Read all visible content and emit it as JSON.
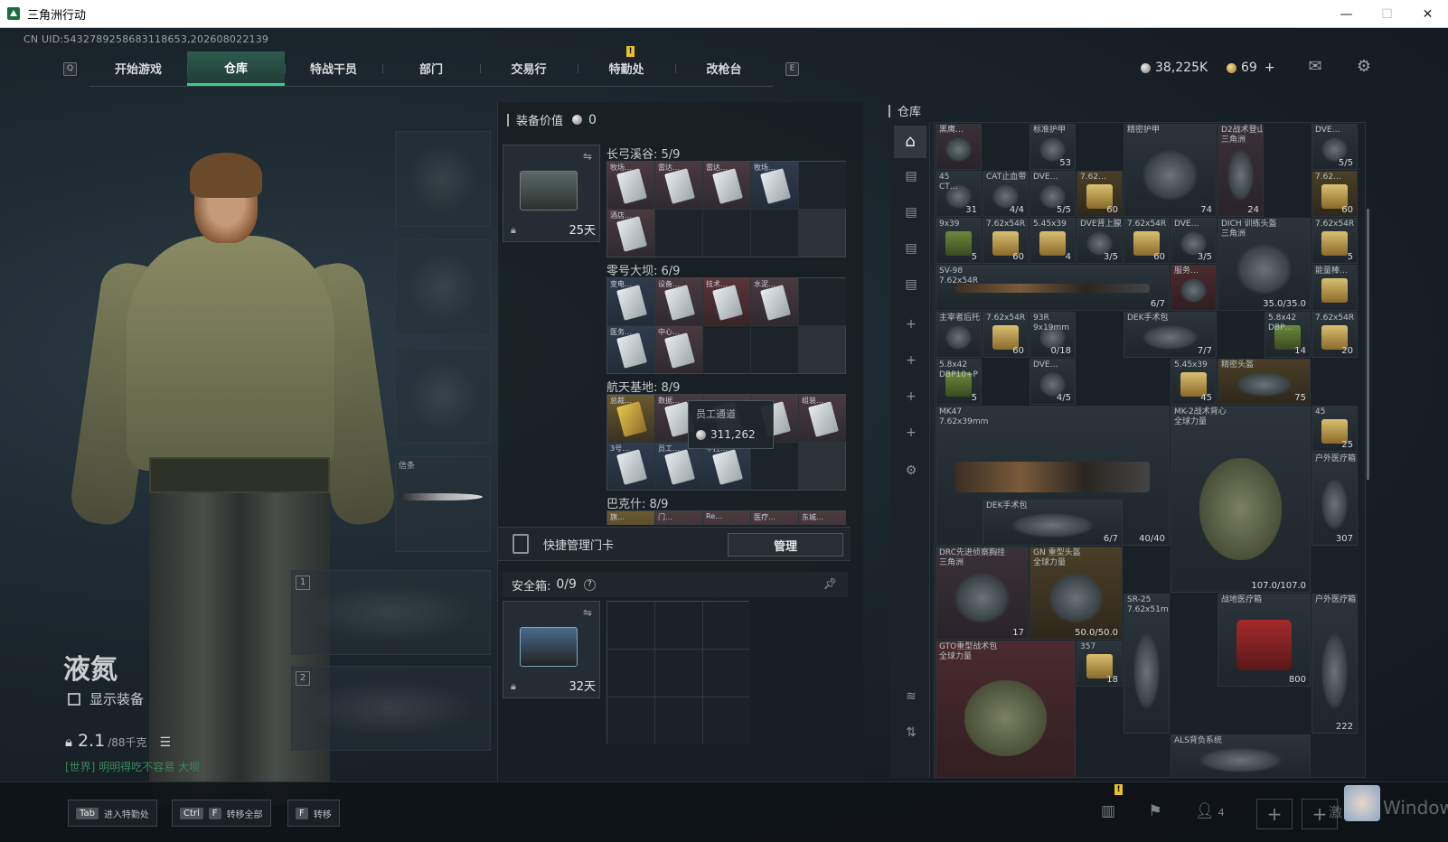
{
  "window": {
    "title": "三角洲行动",
    "minimize": "—",
    "maximize": "☐",
    "close": "✕"
  },
  "uid": "CN UID:5432789258683118653,202608022139",
  "nav": {
    "left_key": "Q",
    "right_key": "E",
    "tabs": [
      "开始游戏",
      "仓库",
      "特战干员",
      "部门",
      "交易行",
      "特勤处",
      "改枪台"
    ],
    "active_tab": "仓库",
    "warn_badge": "!"
  },
  "currency": {
    "silver": "38,225K",
    "gold": "69",
    "add": "+"
  },
  "character": {
    "name": "液氮",
    "show_gear_label": "显示装备",
    "weight": "2.1",
    "weight_max": "/88千克",
    "chat_channel": "[世界]",
    "chat_text": "明明得吃不容易 大坝"
  },
  "slots": {
    "melee_label": "信条",
    "primary_num": "1",
    "secondary_num": "2"
  },
  "middle": {
    "equip_value_label": "装备价值",
    "equip_value": "0",
    "keycase_days": "25天",
    "sections": [
      {
        "title": "长弓溪谷: 5/9",
        "labels": [
          "牧场…",
          "雷达…",
          "雷达…",
          "牧场…",
          "",
          "酒店…"
        ]
      },
      {
        "title": "零号大坝: 6/9",
        "labels": [
          "变电…",
          "设备…",
          "技术…",
          "水泥…",
          "",
          "医务…",
          "中心…"
        ]
      },
      {
        "title": "航天基地: 8/9",
        "labels": [
          "总裁…",
          "数据…",
          "",
          "",
          "组装…",
          "3号…",
          "员工…",
          "中控…"
        ]
      },
      {
        "title": "巴克什: 8/9",
        "labels": [
          "旗…",
          "门…",
          "Re…",
          "医疗…",
          "东城…"
        ]
      }
    ],
    "tooltip": {
      "title": "员工通道",
      "price": "311,262"
    },
    "quick_manage": "快捷管理门卡",
    "manage_button": "管理",
    "safe_label": "安全箱:",
    "safe_count": "0/9",
    "safe_help": "?",
    "safe_days": "32天"
  },
  "warehouse": {
    "title": "仓库",
    "items": [
      {
        "name": "黑鹰…",
        "qty": ""
      },
      {
        "name": "标准护甲",
        "qty": "53"
      },
      {
        "name": "精密护甲",
        "qty": "74"
      },
      {
        "name": "D2战术登山包\n三角洲",
        "qty": "24"
      },
      {
        "name": "DVE…",
        "qty": "5/5"
      },
      {
        "name": "45\nCT…",
        "qty": "31"
      },
      {
        "name": "CAT止血带",
        "qty": "4/4"
      },
      {
        "name": "DVE…",
        "qty": "5/5"
      },
      {
        "name": "7.62…",
        "qty": "60"
      },
      {
        "name": "7.62…",
        "qty": "60"
      },
      {
        "name": "9x39",
        "qty": "5"
      },
      {
        "name": "7.62x54R",
        "qty": "60"
      },
      {
        "name": "5.45x39",
        "qty": "4"
      },
      {
        "name": "DVE肾上腺",
        "qty": "3/5"
      },
      {
        "name": "7.62x54R",
        "qty": "60"
      },
      {
        "name": "DVE…",
        "qty": "3/5"
      },
      {
        "name": "DICH 训练头盔\n三角洲",
        "qty": "35.0/35.0"
      },
      {
        "name": "7.62x54R",
        "qty": "5"
      },
      {
        "name": "SV-98\n7.62x54R",
        "qty": "6/7"
      },
      {
        "name": "服务…",
        "qty": ""
      },
      {
        "name": "能量棒…",
        "qty": ""
      },
      {
        "name": "主宰者后托",
        "qty": ""
      },
      {
        "name": "7.62x54R",
        "qty": "60"
      },
      {
        "name": "93R\n9x19mm",
        "qty": "0/18"
      },
      {
        "name": "DEK手术包",
        "qty": "7/7"
      },
      {
        "name": "5.8x42\nDBP…",
        "qty": "14"
      },
      {
        "name": "7.62x54R",
        "qty": "20"
      },
      {
        "name": "5.8x42\nDBP10+P",
        "qty": "5"
      },
      {
        "name": "DVE…",
        "qty": "4/5"
      },
      {
        "name": "5.45x39",
        "qty": "45"
      },
      {
        "name": "精密头盔",
        "qty": "75"
      },
      {
        "name": "MK47\n7.62x39mm",
        "qty": "40/40"
      },
      {
        "name": "MK-2战术背心\n全球力量",
        "qty": "107.0/107.0"
      },
      {
        "name": "45",
        "qty": "25"
      },
      {
        "name": "户外医疗箱",
        "qty": "307"
      },
      {
        "name": "DEK手术包",
        "qty": "6/7"
      },
      {
        "name": "DRC先进侦察胸挂\n三角洲",
        "qty": "17"
      },
      {
        "name": "GN 重型头盔\n全球力量",
        "qty": "50.0/50.0"
      },
      {
        "name": "SR-25\n7.62x51mm",
        "qty": ""
      },
      {
        "name": "战地医疗箱",
        "qty": "800"
      },
      {
        "name": "户外医疗箱",
        "qty": "222"
      },
      {
        "name": "GTO重型战术包\n全球力量",
        "qty": ""
      },
      {
        "name": "357",
        "qty": "18"
      },
      {
        "name": "ALS背负系统",
        "qty": ""
      }
    ]
  },
  "bottom": {
    "hints": [
      {
        "key": "Tab",
        "key2": "",
        "label": "进入特勤处"
      },
      {
        "key": "Ctrl",
        "key2": "F",
        "label": "转移全部"
      },
      {
        "key": "F",
        "key2": "",
        "label": "转移"
      }
    ],
    "friends": "4",
    "warn_badge": "!",
    "watermark": "Windows",
    "watermark2": "激"
  }
}
